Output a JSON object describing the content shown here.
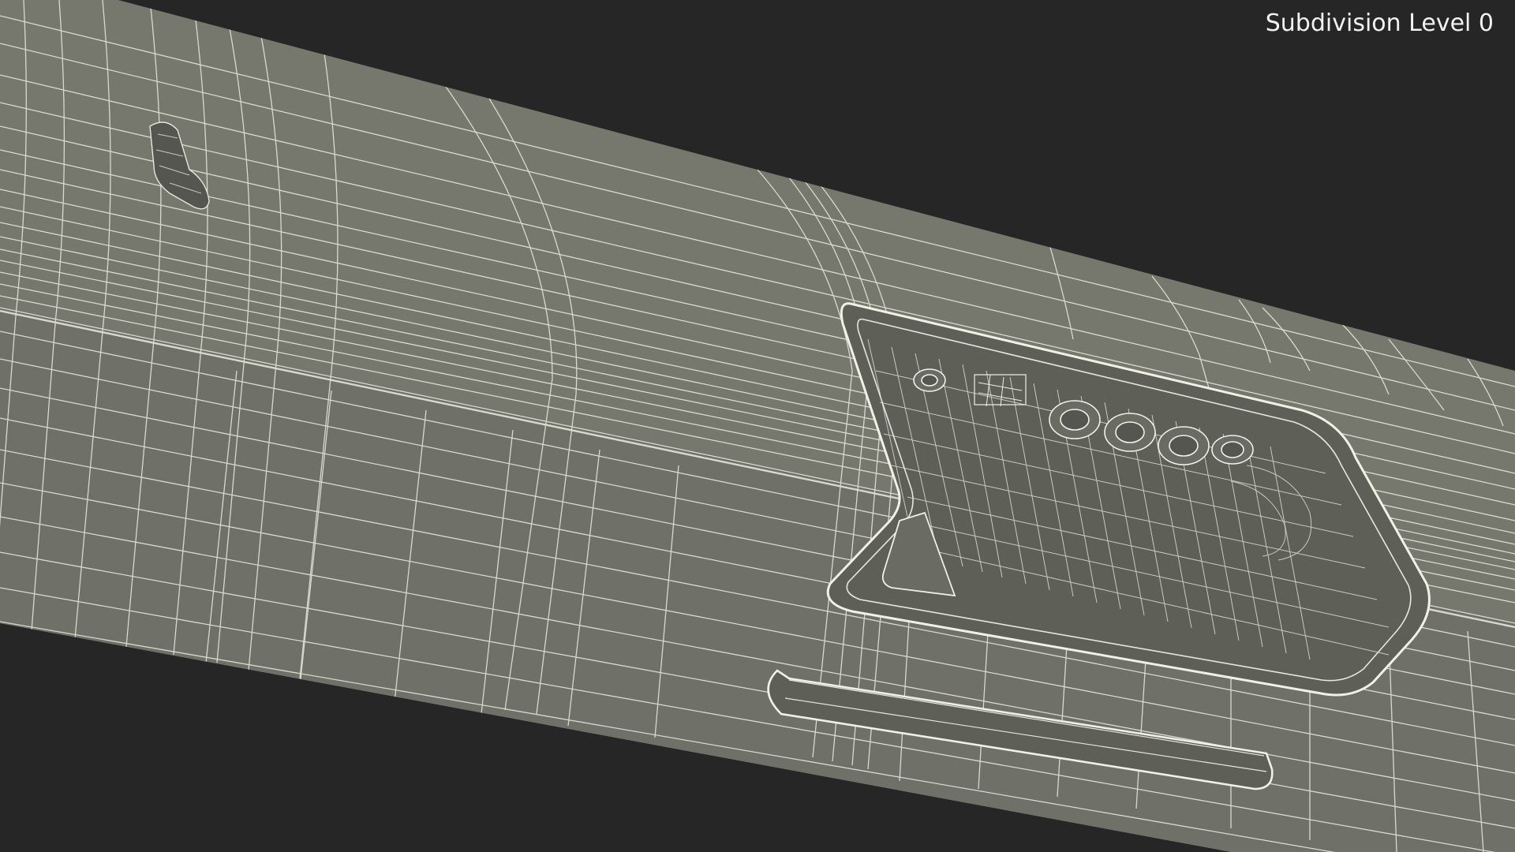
{
  "viewport": {
    "overlay_label": "Subdivision Level 0",
    "label_color": "#f2f2f2",
    "background_color": "#262626",
    "surface_color": "#76776d",
    "recess_color": "#5e5f57",
    "wire_color": "#e6e6dc",
    "render_mode": "wireframe-on-shaded",
    "subdivision_level": 0
  }
}
